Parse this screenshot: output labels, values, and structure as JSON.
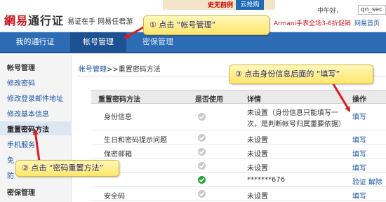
{
  "header": {
    "logo_brand": "網易",
    "logo_product": "通行证",
    "slogan": "易证在手 网易任君游",
    "ad_text": "史无前例",
    "ad_button": "云抢购",
    "greeting": "中午好，",
    "username_value": "qn_sec",
    "promo_text": "Armani手表全场3-6折促销",
    "promo_link": "网易首页"
  },
  "nav": {
    "items": [
      "我的通行证",
      "帐号管理",
      "密保管理"
    ]
  },
  "sidebar": {
    "section1": "帐号管理",
    "items1": [
      "修改密码",
      "修改登录邮件地址",
      "修改基本信息"
    ],
    "active": "重置密码方法",
    "items2": [
      "手机服务",
      "免",
      "防"
    ],
    "section2": "密保管理"
  },
  "breadcrumb": {
    "link": "帐号管理",
    "separator": ">>",
    "current": "重置密码方法"
  },
  "table": {
    "headers": [
      "重置密码方法",
      "是否使用",
      "详情",
      "操作"
    ],
    "rows": [
      {
        "method": "身份信息",
        "detail_1": "未设置（身份信息只能填写一",
        "detail_2": "次，是判断帐号归属重要依据）",
        "action": "填写",
        "used": false
      },
      {
        "method": "生日和密码提示问题",
        "detail_1": "未设置",
        "action": "填写",
        "used": false
      },
      {
        "method": "保密邮箱",
        "detail_1": "未设置",
        "action": "填写",
        "used": false
      },
      {
        "method": "",
        "detail_1": "未设置",
        "action": "填写",
        "used": false
      },
      {
        "method": "",
        "detail_1": "*******676",
        "action": "验证",
        "action2": "解除",
        "used": true
      },
      {
        "method": "安全码",
        "detail_1": "未设置",
        "action": "填写",
        "used": false
      }
    ]
  },
  "callouts": {
    "step1": "① 点击 “帐号管理”",
    "step2": "② 点击 “密码重置方法”",
    "step3": "③ 点击身份信息后面的 “填写”"
  },
  "colors": {
    "brand_red": "#c8161d",
    "nav_blue": "#2c6cb5",
    "link_blue": "#1a57a8",
    "arrow_red": "#d81e1e",
    "check_green": "#27a33a"
  }
}
